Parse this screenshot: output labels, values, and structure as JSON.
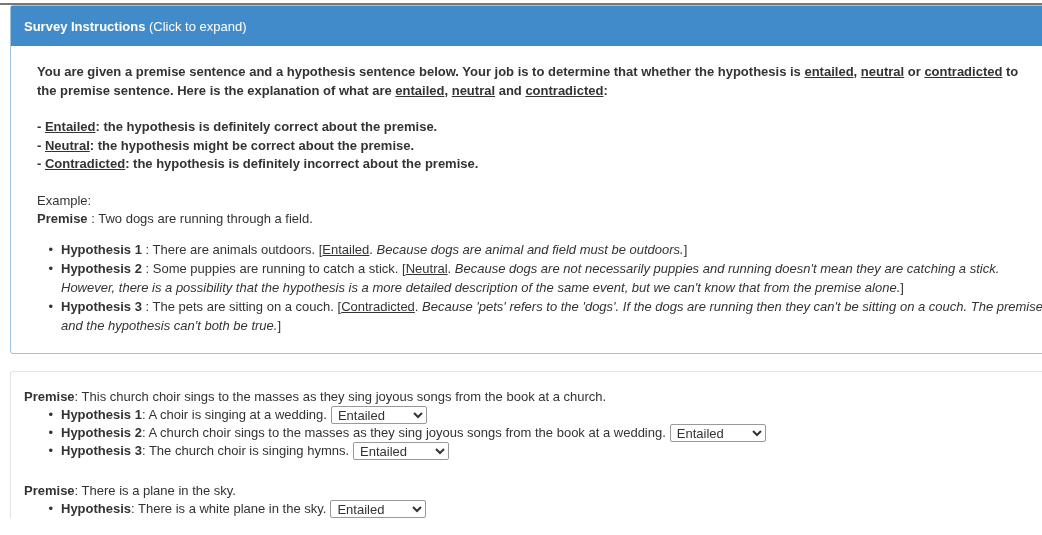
{
  "instructions": {
    "title": "Survey Instructions",
    "title_hint": "(Click to expand)",
    "expanded": true,
    "intro": [
      {
        "kind": "plain",
        "text": "You are given a premise sentence and a hypothesis sentence below. Your job is to determine that whether the hypothesis is "
      },
      {
        "kind": "term",
        "text": "entailed"
      },
      {
        "kind": "plain",
        "text": ", "
      },
      {
        "kind": "term",
        "text": "neutral"
      },
      {
        "kind": "plain",
        "text": " or "
      },
      {
        "kind": "term",
        "text": "contradicted"
      },
      {
        "kind": "plain",
        "text": " to the premise sentence. Here is the explanation of what are "
      },
      {
        "kind": "term",
        "text": "entailed"
      },
      {
        "kind": "plain",
        "text": ", "
      },
      {
        "kind": "term",
        "text": "neutral"
      },
      {
        "kind": "plain",
        "text": " and "
      },
      {
        "kind": "term",
        "text": "contradicted"
      },
      {
        "kind": "plain",
        "text": ":"
      }
    ],
    "definitions": [
      [
        {
          "kind": "plain",
          "text": "- "
        },
        {
          "kind": "term",
          "text": "Entailed"
        },
        {
          "kind": "plain",
          "text": ": the hypothesis is definitely correct about the premise."
        }
      ],
      [
        {
          "kind": "plain",
          "text": "- "
        },
        {
          "kind": "term",
          "text": "Neutral"
        },
        {
          "kind": "plain",
          "text": ": the hypothesis might be correct about the premise."
        }
      ],
      [
        {
          "kind": "plain",
          "text": "- "
        },
        {
          "kind": "term",
          "text": "Contradicted"
        },
        {
          "kind": "plain",
          "text": ": the hypothesis is definitely incorrect about the premise."
        }
      ]
    ],
    "example_label": "Example:",
    "example_premise": [
      {
        "kind": "label",
        "text": "Premise"
      },
      {
        "kind": "plain",
        "text": " : Two dogs are running through a field."
      }
    ],
    "example_hypotheses": [
      {
        "marker": "•",
        "segments": [
          {
            "kind": "label",
            "text": "Hypothesis 1"
          },
          {
            "kind": "plain",
            "text": " : There are animals outdoors. ["
          },
          {
            "kind": "term",
            "text": "Entailed"
          },
          {
            "kind": "plain",
            "text": ". "
          },
          {
            "kind": "reason",
            "text": "Because dogs are animal and field must be outdoors."
          },
          {
            "kind": "plain",
            "text": "]"
          }
        ]
      },
      {
        "marker": "•",
        "segments": [
          {
            "kind": "label",
            "text": "Hypothesis 2"
          },
          {
            "kind": "plain",
            "text": " : Some puppies are running to catch a stick. ["
          },
          {
            "kind": "term",
            "text": "Neutral"
          },
          {
            "kind": "plain",
            "text": ". "
          },
          {
            "kind": "reason",
            "text": "Because dogs are not necessarily puppies and running doesn't mean they are catching a stick. However, there is a possibility that the hypothesis is a more detailed description of the same event, but we can't know that from the premise alone."
          },
          {
            "kind": "plain",
            "text": "]"
          }
        ]
      },
      {
        "marker": "•",
        "segments": [
          {
            "kind": "label",
            "text": "Hypothesis 3"
          },
          {
            "kind": "plain",
            "text": " : The pets are sitting on a couch. ["
          },
          {
            "kind": "term",
            "text": "Contradicted"
          },
          {
            "kind": "plain",
            "text": ". "
          },
          {
            "kind": "reason",
            "text": "Because 'pets' refers to the 'dogs'. If the dogs are running then they can't be sitting on a couch. The premise and the hypothesis can't both be true."
          },
          {
            "kind": "plain",
            "text": "]"
          }
        ]
      }
    ]
  },
  "questions": [
    {
      "premise_label": "Premise",
      "premise": ": This church choir sings to the masses as they sing joyous songs from the book at a church.",
      "hypotheses": [
        {
          "marker": "•",
          "label": "Hypothesis 1",
          "text": ": A choir is singing at a wedding.",
          "answer": "Entailed"
        },
        {
          "marker": "•",
          "label": "Hypothesis 2",
          "text": ": A church choir sings to the masses as they sing joyous songs from the book at a wedding.",
          "answer": "Entailed"
        },
        {
          "marker": "•",
          "label": "Hypothesis 3",
          "text": ": The church choir is singing hymns.",
          "answer": "Entailed"
        }
      ]
    },
    {
      "premise_label": "Premise",
      "premise": ": There is a plane in the sky.",
      "hypotheses": [
        {
          "marker": "•",
          "label": "Hypothesis",
          "text": ": There is a white plane in the sky.",
          "answer": "Entailed"
        }
      ]
    }
  ]
}
